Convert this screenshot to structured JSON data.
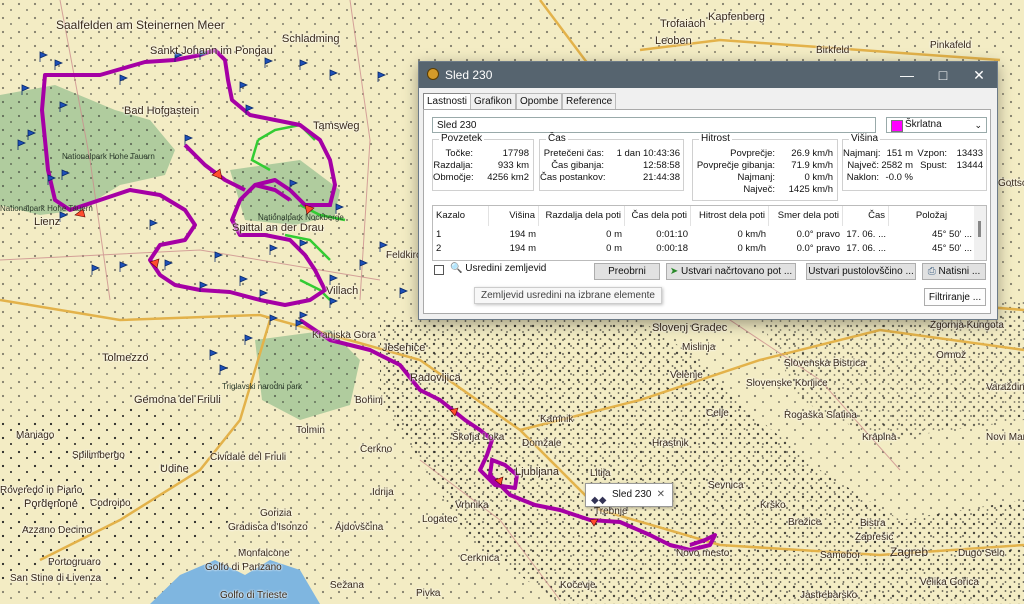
{
  "map": {
    "places": [
      {
        "text": "Saalfelden am Steinernen Meer",
        "size": "big"
      },
      {
        "text": "Sankt Johann im Pongau",
        "size": "med"
      },
      {
        "text": "Schladming",
        "size": "med"
      },
      {
        "text": "Trofaiach",
        "size": "med"
      },
      {
        "text": "Leoben",
        "size": "med"
      },
      {
        "text": "Kapfenberg",
        "size": "med"
      },
      {
        "text": "Birkfeld",
        "size": "small"
      },
      {
        "text": "Pinkafeld",
        "size": "small"
      },
      {
        "text": "Bad Hofgastein",
        "size": "med"
      },
      {
        "text": "Tamsweg",
        "size": "med"
      },
      {
        "text": "Lienz",
        "size": "med"
      },
      {
        "text": "Spittal an der Drau",
        "size": "med"
      },
      {
        "text": "Villach",
        "size": "med"
      },
      {
        "text": "Feldkirchen",
        "size": "small"
      },
      {
        "text": "Kranjska Gora",
        "size": "small"
      },
      {
        "text": "Jesenice",
        "size": "med"
      },
      {
        "text": "Tolmezzo",
        "size": "med"
      },
      {
        "text": "Radovljica",
        "size": "med"
      },
      {
        "text": "Bohinj",
        "size": "small"
      },
      {
        "text": "Gemona del Friuli",
        "size": "med"
      },
      {
        "text": "Tolmin",
        "size": "small"
      },
      {
        "text": "Maniago",
        "size": "small"
      },
      {
        "text": "Spilimbergo",
        "size": "small"
      },
      {
        "text": "Udine",
        "size": "med"
      },
      {
        "text": "Cividale del Friuli",
        "size": "small"
      },
      {
        "text": "Cerkno",
        "size": "small"
      },
      {
        "text": "Škofja Loka",
        "size": "small"
      },
      {
        "text": "Kamnik",
        "size": "small"
      },
      {
        "text": "Domžale",
        "size": "small"
      },
      {
        "text": "Ljubljana",
        "size": "med"
      },
      {
        "text": "Litija",
        "size": "small"
      },
      {
        "text": "Hrastnik",
        "size": "small"
      },
      {
        "text": "Celje",
        "size": "small"
      },
      {
        "text": "Velenje",
        "size": "small"
      },
      {
        "text": "Slovenj Gradec",
        "size": "med"
      },
      {
        "text": "Mislinja",
        "size": "small"
      },
      {
        "text": "Slovenska Bistrica",
        "size": "small"
      },
      {
        "text": "Slovenske Konjice",
        "size": "small"
      },
      {
        "text": "Rogaška Slatina",
        "size": "small"
      },
      {
        "text": "Krapina",
        "size": "small"
      },
      {
        "text": "Ormož",
        "size": "small"
      },
      {
        "text": "Varaždin",
        "size": "small"
      },
      {
        "text": "Novi Marof",
        "size": "small"
      },
      {
        "text": "Sevnica",
        "size": "small"
      },
      {
        "text": "Krško",
        "size": "small"
      },
      {
        "text": "Brežice",
        "size": "small"
      },
      {
        "text": "Samobor",
        "size": "small"
      },
      {
        "text": "Zagreb",
        "size": "big"
      },
      {
        "text": "Zaprešić",
        "size": "small"
      },
      {
        "text": "Bistra",
        "size": "small"
      },
      {
        "text": "Dugo Selo",
        "size": "small"
      },
      {
        "text": "Velika Gorica",
        "size": "small"
      },
      {
        "text": "Jastrebarsko",
        "size": "small"
      },
      {
        "text": "Novo mesto",
        "size": "small"
      },
      {
        "text": "Trebnje",
        "size": "small"
      },
      {
        "text": "Kočevje",
        "size": "small"
      },
      {
        "text": "Idrija",
        "size": "small"
      },
      {
        "text": "Vrhnika",
        "size": "small"
      },
      {
        "text": "Logatec",
        "size": "small"
      },
      {
        "text": "Cerknica",
        "size": "small"
      },
      {
        "text": "Ajdovščina",
        "size": "small"
      },
      {
        "text": "Gorizia",
        "size": "small"
      },
      {
        "text": "Gradisca d'Isonzo",
        "size": "small"
      },
      {
        "text": "Monfalcone",
        "size": "small"
      },
      {
        "text": "Golfo di Panzano",
        "size": "small"
      },
      {
        "text": "Golfo di Trieste",
        "size": "small"
      },
      {
        "text": "Sežana",
        "size": "small"
      },
      {
        "text": "Pivka",
        "size": "small"
      },
      {
        "text": "Pordenone",
        "size": "med"
      },
      {
        "text": "Codroipo",
        "size": "small"
      },
      {
        "text": "Azzano Decimo",
        "size": "small"
      },
      {
        "text": "Portogruaro",
        "size": "small"
      },
      {
        "text": "San Stino di Livenza",
        "size": "small"
      },
      {
        "text": "Roveredo in Piano",
        "size": "small"
      },
      {
        "text": "Zgornja Kungota",
        "size": "small"
      },
      {
        "text": "Gottschee",
        "size": "small"
      }
    ],
    "parks": [
      {
        "text": "Nationalpark Hohe Tauern"
      },
      {
        "text": "Nationalpark Hohe Tauern"
      },
      {
        "text": "Nationalpark Nockberge"
      },
      {
        "text": "Triglavski narodni park"
      }
    ]
  },
  "dialog": {
    "title": "Sled 230",
    "tabs": [
      "Lastnosti",
      "Grafikon",
      "Opombe",
      "Reference"
    ],
    "name_value": "Sled 230",
    "color_value": "Škrlatna",
    "color_hex": "#ff00ff",
    "summary": {
      "title": "Povzetek",
      "points_label": "Točke:",
      "points_value": "17798",
      "distance_label": "Razdalja:",
      "distance_value": "933 km",
      "area_label": "Območje:",
      "area_value": "4256 km2"
    },
    "time": {
      "title": "Čas",
      "elapsed_label": "Pretečeni čas:",
      "elapsed_value": "1 dan 10:43:36",
      "moving_label": "Čas gibanja:",
      "moving_value": "12:58:58",
      "stopped_label": "Čas postankov:",
      "stopped_value": "21:44:38"
    },
    "speed": {
      "title": "Hitrost",
      "avg_label": "Povprečje:",
      "avg_value": "26.9 km/h",
      "moving_avg_label": "Povprečje gibanja:",
      "moving_avg_value": "71.9 km/h",
      "min_label": "Najmanj:",
      "min_value": "0 km/h",
      "max_label": "Največ:",
      "max_value": "1425 km/h"
    },
    "elevation": {
      "title": "Višina",
      "min_label": "Najmanj:",
      "min_value": "151 m",
      "max_label": "Največ:",
      "max_value": "2582 m",
      "grade_label": "Naklon:",
      "grade_value": "-0.0 %",
      "ascent_label": "Vzpon:",
      "ascent_value": "13433",
      "descent_label": "Spust:",
      "descent_value": "13444"
    },
    "table": {
      "headers": [
        "Kazalo",
        "Višina",
        "Razdalja dela poti",
        "Čas dela poti",
        "Hitrost dela poti",
        "Smer dela poti",
        "Čas",
        "Položaj"
      ],
      "rows": [
        [
          "1",
          "194 m",
          "0 m",
          "0:01:10",
          "0 km/h",
          "0.0° pravo",
          "17. 06. ...",
          "45° 50' ..."
        ],
        [
          "2",
          "194 m",
          "0 m",
          "0:00:18",
          "0 km/h",
          "0.0° pravo",
          "17. 06. ...",
          "45° 50' ..."
        ]
      ]
    },
    "center_map_label": "Usredini zemljevid",
    "buttons": {
      "invert": "Preobrni",
      "create_loaded": "Ustvari načrtovano pot ...",
      "create_adventure": "Ustvari pustolovščino ...",
      "print": "Natisni ...",
      "filter": "Filtriranje ..."
    },
    "tooltip": "Zemljevid usredini na izbrane elemente"
  },
  "track_tag": {
    "label": "Sled 230"
  }
}
